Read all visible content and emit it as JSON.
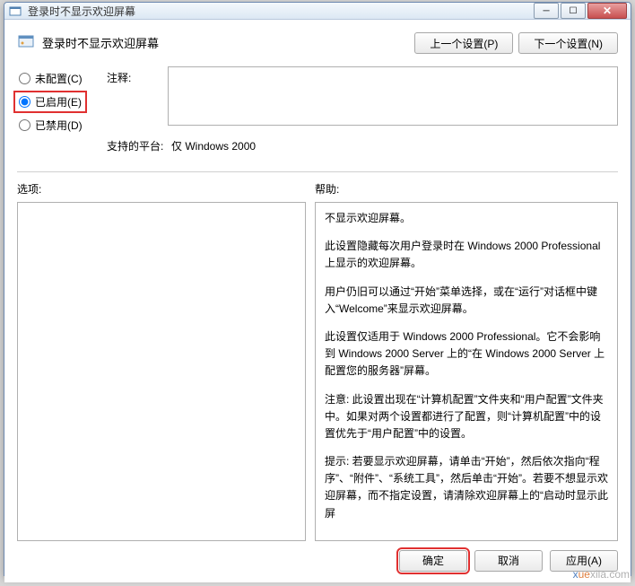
{
  "window": {
    "title": "登录时不显示欢迎屏幕"
  },
  "header": {
    "title": "登录时不显示欢迎屏幕",
    "prev_btn": "上一个设置(P)",
    "next_btn": "下一个设置(N)"
  },
  "radios": {
    "not_configured": "未配置(C)",
    "enabled": "已启用(E)",
    "disabled": "已禁用(D)"
  },
  "fields": {
    "comment_label": "注释:",
    "comment_value": "",
    "platform_label": "支持的平台:",
    "platform_value": "仅 Windows 2000"
  },
  "panels": {
    "options_label": "选项:",
    "help_label": "帮助:"
  },
  "help": {
    "p1": "不显示欢迎屏幕。",
    "p2": "此设置隐藏每次用户登录时在 Windows 2000 Professional 上显示的欢迎屏幕。",
    "p3": "用户仍旧可以通过“开始”菜单选择，或在“运行”对话框中键入“Welcome”来显示欢迎屏幕。",
    "p4": "此设置仅适用于 Windows 2000 Professional。它不会影响到 Windows 2000 Server 上的“在 Windows 2000 Server 上配置您的服务器”屏幕。",
    "p5": "注意: 此设置出现在“计算机配置”文件夹和“用户配置”文件夹中。如果对两个设置都进行了配置，则“计算机配置”中的设置优先于“用户配置”中的设置。",
    "p6": "提示: 若要显示欢迎屏幕，请单击“开始”，然后依次指向“程序”、“附件”、“系统工具”，然后单击“开始”。若要不想显示欢迎屏幕，而不指定设置，请清除欢迎屏幕上的“启动时显示此屏"
  },
  "footer": {
    "ok": "确定",
    "cancel": "取消",
    "apply": "应用(A)"
  },
  "watermark": {
    "a": "x",
    "b": "ue",
    "c": "xila.com"
  }
}
